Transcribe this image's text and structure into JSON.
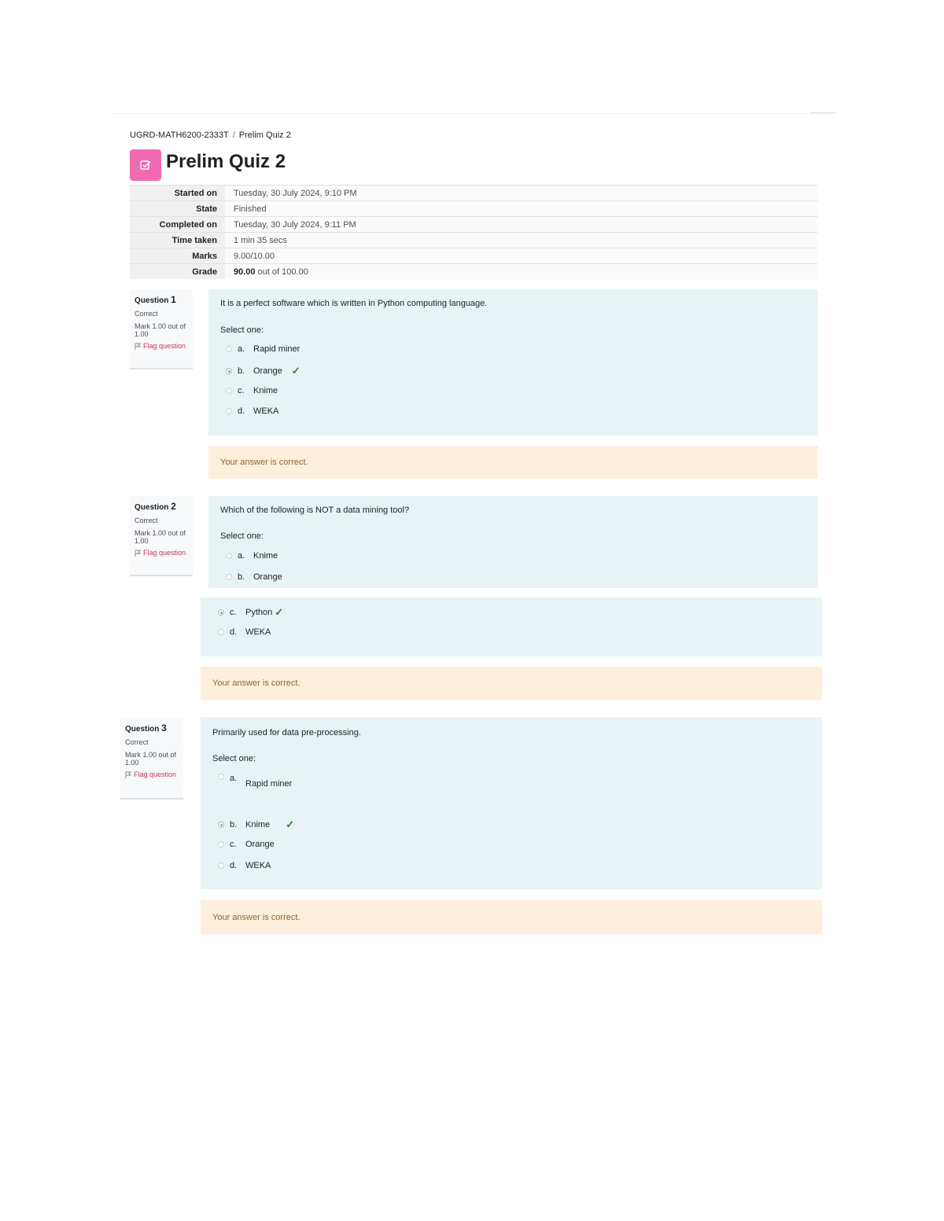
{
  "breadcrumb": {
    "course": "UGRD-MATH6200-2333T",
    "current": "Prelim Quiz 2"
  },
  "page_title": "Prelim Quiz 2",
  "summary": [
    {
      "label": "Started on",
      "value": "Tuesday, 30 July 2024, 9:10 PM"
    },
    {
      "label": "State",
      "value": "Finished"
    },
    {
      "label": "Completed on",
      "value": "Tuesday, 30 July 2024, 9:11 PM"
    },
    {
      "label": "Time taken",
      "value": "1 min 35 secs"
    },
    {
      "label": "Marks",
      "value": "9.00/10.00"
    },
    {
      "label": "Grade",
      "value_bold": "90.00",
      "value_rest": " out of 100.00"
    }
  ],
  "questions": [
    {
      "label": "Question",
      "number": "1",
      "state": "Correct",
      "mark": "Mark 1.00 out of 1.00",
      "flag": "Flag question",
      "text": "It is a perfect software which is written in Python computing language.",
      "prompt": "Select one:",
      "options": [
        {
          "letter": "a.",
          "text": "Rapid miner"
        },
        {
          "letter": "b.",
          "text": "Orange"
        },
        {
          "letter": "c.",
          "text": "Knime"
        },
        {
          "letter": "d.",
          "text": "WEKA"
        }
      ],
      "tick": "✓",
      "feedback": "Your answer is correct."
    },
    {
      "label": "Question",
      "number": "2",
      "state": "Correct",
      "mark": "Mark 1.00 out of 1.00",
      "flag": "Flag question",
      "text": "Which of the following is NOT a data mining tool?",
      "prompt": "Select one:",
      "options": [
        {
          "letter": "a.",
          "text": "Knime"
        },
        {
          "letter": "b.",
          "text": "Orange"
        },
        {
          "letter": "c.",
          "text": "Python"
        },
        {
          "letter": "d.",
          "text": "WEKA"
        }
      ],
      "tick": "✓",
      "feedback": "Your answer is correct."
    },
    {
      "label": "Question",
      "number": "3",
      "state": "Correct",
      "mark": "Mark 1.00 out of 1.00",
      "flag": "Flag question",
      "text": "Primarily used for data pre-processing.",
      "prompt": "Select one:",
      "options": [
        {
          "letter": "a.",
          "text": "Rapid miner"
        },
        {
          "letter": "b.",
          "text": "Knime"
        },
        {
          "letter": "c.",
          "text": "Orange"
        },
        {
          "letter": "d.",
          "text": "WEKA"
        }
      ],
      "tick": "✓",
      "feedback": "Your answer is correct."
    }
  ],
  "colors": {
    "accent_icon": "#f06bb2",
    "answer_bg": "#e7f3f5",
    "feedback_bg": "#fcefdc",
    "feedback_text": "#8e662e",
    "tick": "#357a32",
    "flag": "#c5365a"
  }
}
